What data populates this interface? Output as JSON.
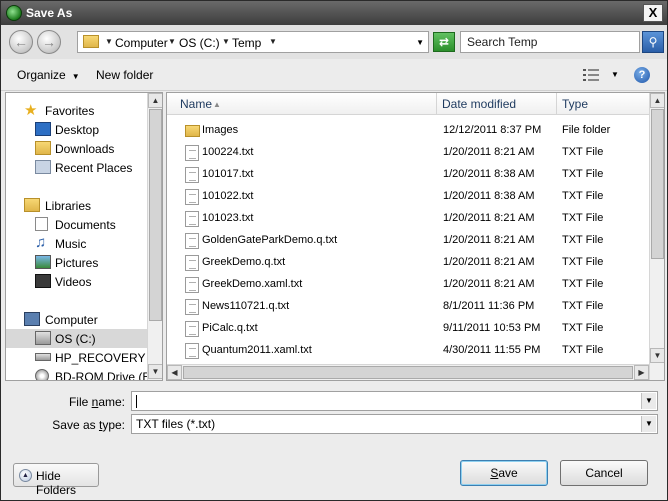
{
  "window": {
    "title": "Save As",
    "close_label": "X"
  },
  "address": {
    "crumbs": [
      "Computer",
      "OS (C:)",
      "Temp"
    ],
    "search_placeholder": "Search Temp"
  },
  "toolbar": {
    "organize": "Organize",
    "new_folder": "New folder",
    "help": "?"
  },
  "nav": {
    "items": [
      {
        "label": "Favorites",
        "icon": "star-icon"
      },
      {
        "label": "Desktop",
        "icon": "desktop-icon"
      },
      {
        "label": "Downloads",
        "icon": "downloads-folder-icon"
      },
      {
        "label": "Recent Places",
        "icon": "recent-places-icon"
      },
      {
        "label": "Libraries",
        "icon": "libraries-icon"
      },
      {
        "label": "Documents",
        "icon": "documents-icon"
      },
      {
        "label": "Music",
        "icon": "music-icon"
      },
      {
        "label": "Pictures",
        "icon": "pictures-icon"
      },
      {
        "label": "Videos",
        "icon": "videos-icon"
      },
      {
        "label": "Computer",
        "icon": "computer-icon"
      },
      {
        "label": "OS (C:)",
        "icon": "drive-icon"
      },
      {
        "label": "HP_RECOVERY (D:",
        "icon": "drive-icon"
      },
      {
        "label": "BD-ROM Drive (E:)",
        "icon": "optical-drive-icon"
      }
    ]
  },
  "files": {
    "columns": [
      "Name",
      "Date modified",
      "Type"
    ],
    "rows": [
      {
        "name": "Images",
        "date": "12/12/2011 8:37 PM",
        "type": "File folder",
        "kind": "folder"
      },
      {
        "name": "100224.txt",
        "date": "1/20/2011 8:21 AM",
        "type": "TXT File",
        "kind": "txt"
      },
      {
        "name": "101017.txt",
        "date": "1/20/2011 8:38 AM",
        "type": "TXT File",
        "kind": "txt"
      },
      {
        "name": "101022.txt",
        "date": "1/20/2011 8:38 AM",
        "type": "TXT File",
        "kind": "txt"
      },
      {
        "name": "101023.txt",
        "date": "1/20/2011 8:21 AM",
        "type": "TXT File",
        "kind": "txt"
      },
      {
        "name": "GoldenGateParkDemo.q.txt",
        "date": "1/20/2011 8:21 AM",
        "type": "TXT File",
        "kind": "txt"
      },
      {
        "name": "GreekDemo.q.txt",
        "date": "1/20/2011 8:21 AM",
        "type": "TXT File",
        "kind": "txt"
      },
      {
        "name": "GreekDemo.xaml.txt",
        "date": "1/20/2011 8:21 AM",
        "type": "TXT File",
        "kind": "txt"
      },
      {
        "name": "News110721.q.txt",
        "date": "8/1/2011 11:36 PM",
        "type": "TXT File",
        "kind": "txt"
      },
      {
        "name": "PiCalc.q.txt",
        "date": "9/11/2011 10:53 PM",
        "type": "TXT File",
        "kind": "txt"
      },
      {
        "name": "Quantum2011.xaml.txt",
        "date": "4/30/2011 11:55 PM",
        "type": "TXT File",
        "kind": "txt"
      }
    ]
  },
  "form": {
    "file_name_label_pre": "File ",
    "file_name_label_u": "n",
    "file_name_label_post": "ame:",
    "file_name_value": "",
    "save_type_label_pre": "Save as ",
    "save_type_label_u": "t",
    "save_type_label_post": "ype:",
    "save_type_value": "TXT files (*.txt)"
  },
  "buttons": {
    "hide_folders": "Hide Folders",
    "save_u": "S",
    "save_rest": "ave",
    "cancel": "Cancel"
  }
}
